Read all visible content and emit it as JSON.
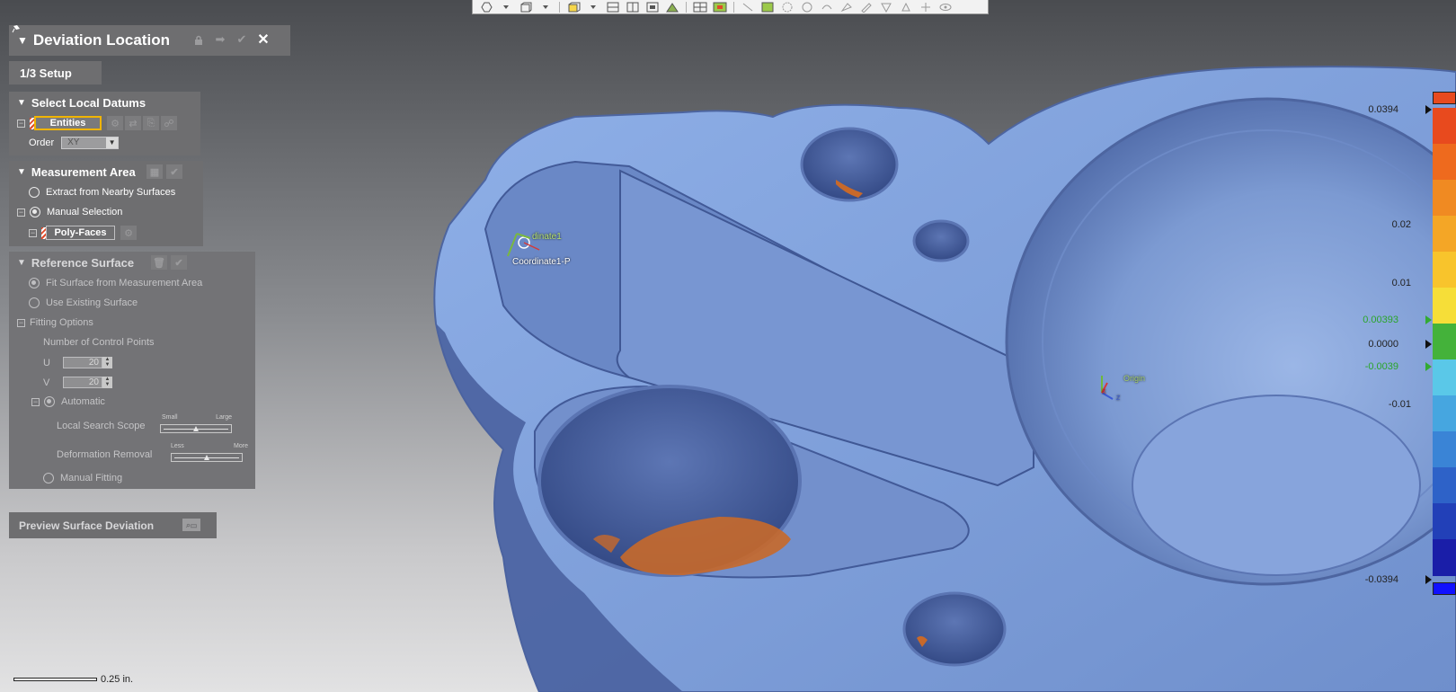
{
  "panel": {
    "title": "Deviation Location",
    "step_tab": "1/3 Setup",
    "select_local_datums": {
      "header": "Select Local Datums",
      "entities_label": "Entities",
      "order_label": "Order",
      "order_value": "XY"
    },
    "measurement_area": {
      "header": "Measurement Area",
      "option_extract": "Extract from Nearby Surfaces",
      "option_manual": "Manual Selection",
      "polyfaces_label": "Poly-Faces"
    },
    "reference_surface": {
      "header": "Reference Surface",
      "option_fit": "Fit Surface from Measurement Area",
      "option_existing": "Use Existing Surface",
      "fitting_options": "Fitting Options",
      "control_points_label": "Number of Control Points",
      "u_label": "U",
      "u_value": "20",
      "v_label": "V",
      "v_value": "20",
      "automatic_label": "Automatic",
      "local_search_label": "Local Search Scope",
      "local_search_small": "Small",
      "local_search_large": "Large",
      "local_search_level": 0.5,
      "deformation_label": "Deformation Removal",
      "deformation_less": "Less",
      "deformation_more": "More",
      "deformation_level": 0.5,
      "manual_fitting_label": "Manual Fitting"
    },
    "preview_button": "Preview Surface Deviation"
  },
  "viewport": {
    "coordinate_label_1": "dinate1",
    "coordinate_label_2": "Coordinate1-P",
    "origin_label": "Origin",
    "axis_x": "X",
    "axis_z": "Z",
    "model_color": "#7ea0d8"
  },
  "color_scale": {
    "max_label": "0.0394",
    "l002": "0.02",
    "l001": "0.01",
    "tol_upper": "0.00393",
    "zero": "0.0000",
    "tol_lower": "-0.0039",
    "lm001": "-0.01",
    "min_label": "-0.0394",
    "colors": [
      "#e84a1e",
      "#ee6a1e",
      "#f08a22",
      "#f4a626",
      "#f8c42c",
      "#f6de38",
      "#44b23a",
      "#5ac8e8",
      "#46a6e0",
      "#3a84d6",
      "#2e62c8",
      "#2240b8",
      "#1a1ea8",
      "#1010ff"
    ]
  },
  "scale_bar": {
    "label": "0.25 in."
  }
}
